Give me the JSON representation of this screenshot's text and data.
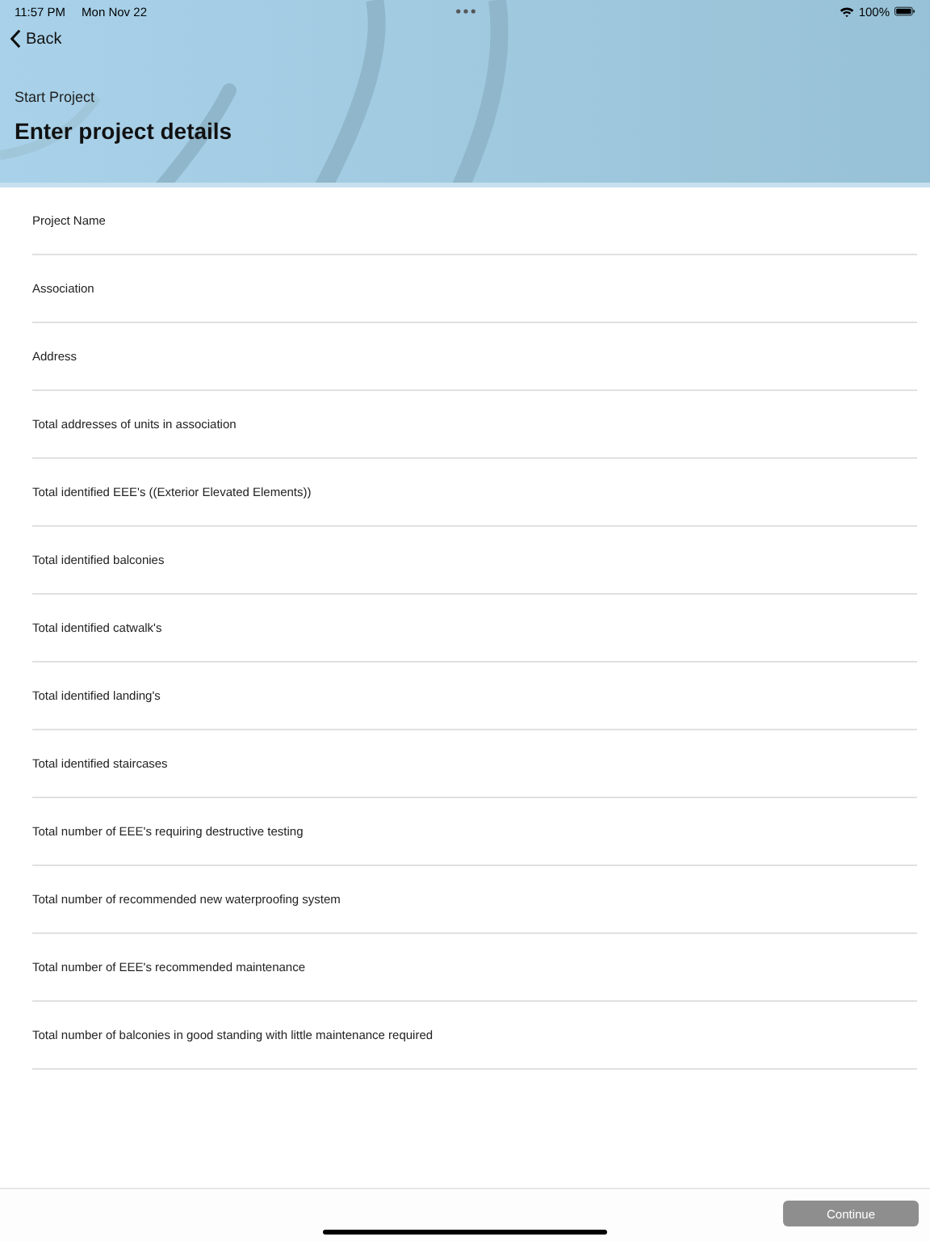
{
  "status_bar": {
    "time": "11:57 PM",
    "date": "Mon Nov 22",
    "battery": "100%"
  },
  "nav": {
    "back": "Back",
    "subtitle": "Start Project",
    "title": "Enter project details"
  },
  "fields": [
    {
      "label": "Project Name"
    },
    {
      "label": "Association"
    },
    {
      "label": "Address"
    },
    {
      "label": "Total addresses of units in association"
    },
    {
      "label": "Total identified EEE's ((Exterior Elevated Elements))"
    },
    {
      "label": "Total identified balconies"
    },
    {
      "label": "Total identified catwalk's"
    },
    {
      "label": "Total identified landing's"
    },
    {
      "label": "Total identified staircases"
    },
    {
      "label": "Total number of EEE's requiring destructive testing"
    },
    {
      "label": "Total number of recommended new waterproofing system"
    },
    {
      "label": "Total number of EEE's recommended maintenance"
    },
    {
      "label": "Total number of balconies in good standing with little maintenance required"
    }
  ],
  "continue_button": {
    "label": "Continue",
    "disabled": true
  }
}
